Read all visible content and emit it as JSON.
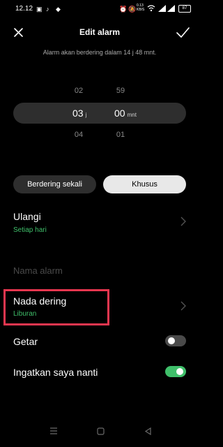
{
  "status_bar": {
    "time": "12.12",
    "icons": [
      "gallery-icon",
      "tiktok-icon",
      "android-icon",
      "alarm-icon",
      "mute-icon",
      "speed-icon",
      "wifi-icon",
      "signal-icon",
      "battery-icon"
    ],
    "net_speed": "0.13\nKB/S",
    "battery": "87"
  },
  "header": {
    "title": "Edit alarm",
    "subtitle": "Alarm akan berdering dalam 14 j 48 mnt."
  },
  "picker": {
    "hour_prev": "02",
    "hour_selected": "03",
    "hour_unit": "j",
    "hour_next": "04",
    "minute_prev": "59",
    "minute_selected": "00",
    "minute_unit": "mnt",
    "minute_next": "01"
  },
  "repeat_mode": {
    "once_label": "Berdering sekali",
    "custom_label": "Khusus",
    "selected": "Khusus"
  },
  "repeat": {
    "title": "Ulangi",
    "value": "Setiap hari"
  },
  "alarm_name": {
    "placeholder": "Nama alarm"
  },
  "ringtone": {
    "title": "Nada dering",
    "value": "Liburan"
  },
  "vibrate": {
    "title": "Getar",
    "enabled": false
  },
  "snooze": {
    "title": "Ingatkan saya nanti",
    "enabled": true
  },
  "colors": {
    "accent_green": "#3fbf6a",
    "highlight_red": "#e8364f",
    "background": "#000000"
  }
}
